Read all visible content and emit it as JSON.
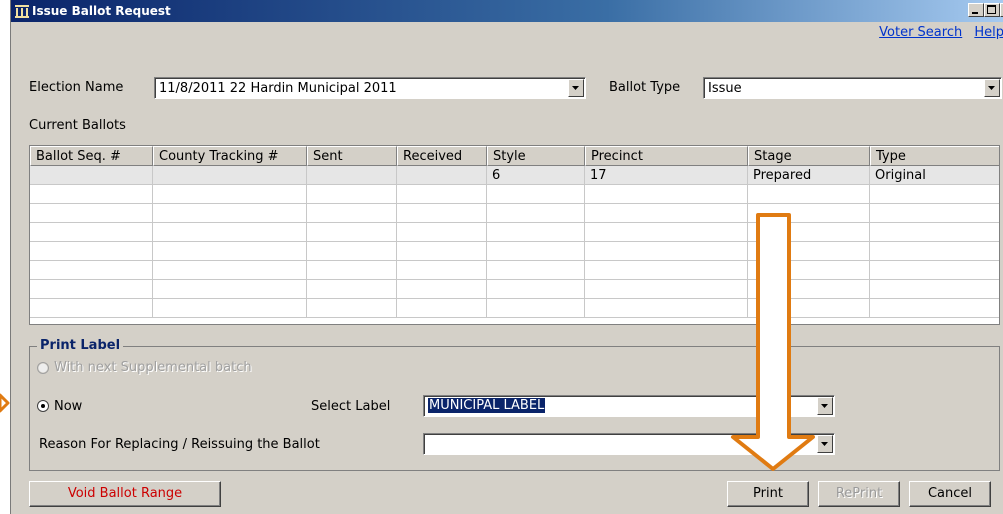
{
  "window": {
    "title": "Issue Ballot Request"
  },
  "links": {
    "voter_search": "Voter Search",
    "help": "Help"
  },
  "election": {
    "label": "Election Name",
    "value": "11/8/2011 22 Hardin Municipal 2011"
  },
  "ballot_type": {
    "label": "Ballot Type",
    "value": "Issue"
  },
  "current_ballots": {
    "label": "Current Ballots",
    "columns": [
      "Ballot Seq. #",
      "County Tracking #",
      "Sent",
      "Received",
      "Style",
      "Precinct",
      "Stage",
      "Type"
    ],
    "rows": [
      [
        "",
        "",
        "",
        "",
        "6",
        "17",
        "Prepared",
        "Original"
      ]
    ]
  },
  "print_label": {
    "legend": "Print Label",
    "option_supplemental": "With next Supplemental batch",
    "option_now": "Now",
    "selected_option": "now",
    "select_label": {
      "label": "Select Label",
      "value": "MUNICIPAL LABEL"
    },
    "reason": {
      "label": "Reason For Replacing / Reissuing the Ballot",
      "value": ""
    }
  },
  "buttons": {
    "void_range": "Void Ballot Range",
    "print": "Print",
    "reprint": "RePrint",
    "cancel": "Cancel"
  },
  "colors": {
    "void_text": "#cc0000",
    "link": "#0033cc",
    "annotation_arrow": "#e07b12",
    "legend": "#0a246a"
  }
}
